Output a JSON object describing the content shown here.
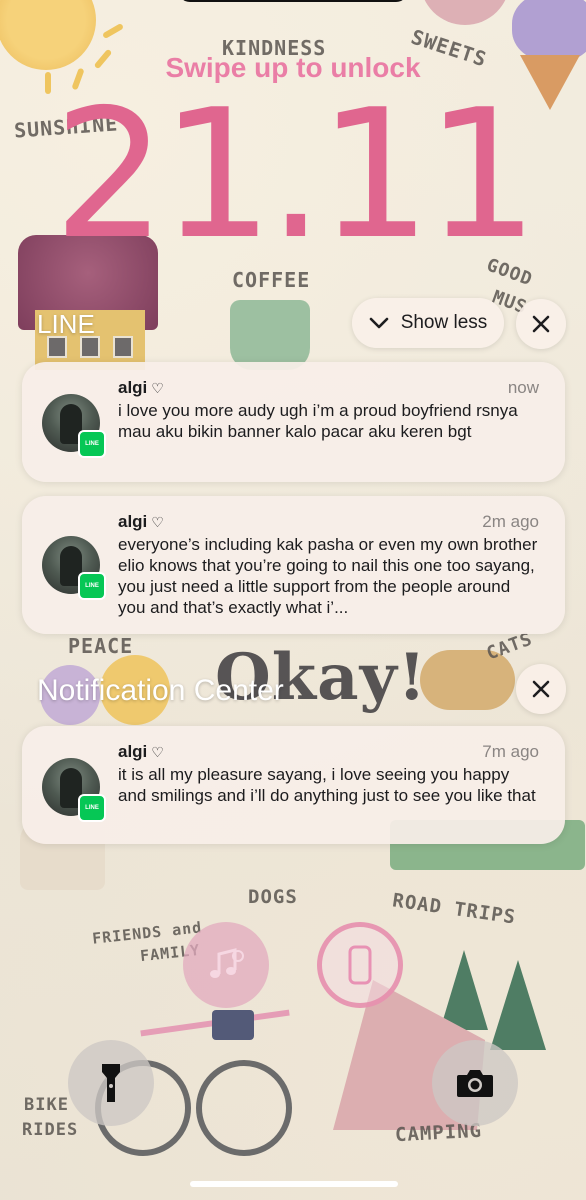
{
  "lockscreen": {
    "hint": "Swipe up to unlock",
    "time": "21.11"
  },
  "line_group": {
    "title": "LINE",
    "show_less_label": "Show less",
    "notifications": [
      {
        "sender": "algi",
        "time": "now",
        "message": "i love you more audy ugh i’m a proud boyfriend rsnya mau aku bikin banner kalo pacar aku keren bgt"
      },
      {
        "sender": "algi",
        "time": "2m ago",
        "message": "everyone’s including kak pasha or even my own brother elio knows that you’re going to nail this one too sayang, you just need a little support from the people around you and that’s exactly what i’..."
      }
    ]
  },
  "notification_center": {
    "title": "Notification Center",
    "notifications": [
      {
        "sender": "algi",
        "time": "7m ago",
        "message": "it is all my pleasure sayang, i love seeing you happy and smilings and i’ll do anything just to see you like that"
      }
    ]
  },
  "wallpaper_labels": {
    "kindness": "KINDNESS",
    "sweets": "SWEETS",
    "sunshine": "SUNSHINE",
    "coffee": "COFFEE",
    "good": "GOOD",
    "mus": "MUS",
    "peace": "PEACE",
    "okay": "Okay!",
    "cats": "CATS",
    "dogs": "DOGS",
    "road_trips": "ROAD TRIPS",
    "friends": "FRIENDS and",
    "family": "FAMILY",
    "bike": "BIKE",
    "rides": "RIDES",
    "camping": "CAMPING"
  },
  "icons": {
    "flashlight": "flashlight-icon",
    "camera": "camera-icon",
    "music": "music-search-icon",
    "phone": "phone-icon",
    "chevron": "chevron-down-icon",
    "close": "close-icon",
    "app_badge": "line-app-icon"
  },
  "colors": {
    "clock": "#e0668f",
    "hint": "#ea7ea6",
    "line_green": "#06c755"
  }
}
